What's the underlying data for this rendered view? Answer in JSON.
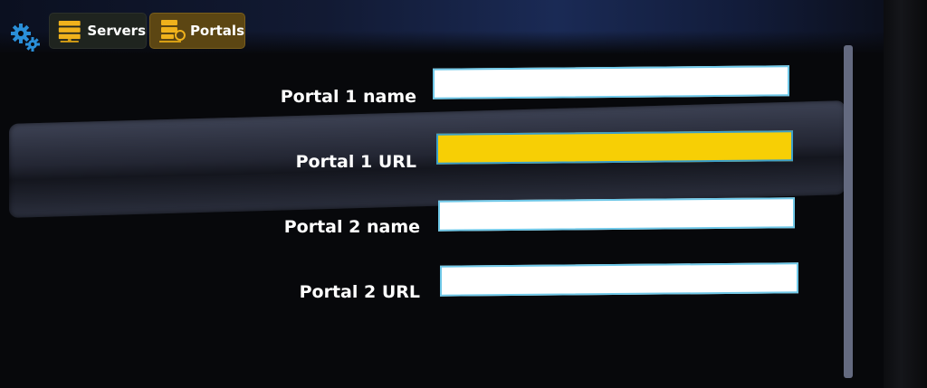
{
  "toolbar": {
    "settings_icon": "gear-icon",
    "tabs": [
      {
        "label": "Servers",
        "icon": "server-stack-icon",
        "active": false
      },
      {
        "label": "Portals",
        "icon": "portal-server-icon",
        "active": true
      }
    ]
  },
  "form": {
    "fields": [
      {
        "label": "Portal 1 name",
        "value": "",
        "focused": false
      },
      {
        "label": "Portal 1 URL",
        "value": "",
        "focused": true
      },
      {
        "label": "Portal 2 name",
        "value": "",
        "focused": false
      },
      {
        "label": "Portal 2 URL",
        "value": "",
        "focused": false
      }
    ]
  },
  "colors": {
    "accent_yellow": "#f7cf05",
    "field_border": "#6fc8e8",
    "portals_tab": "#5c4613",
    "gear": "#2a8fd8"
  }
}
